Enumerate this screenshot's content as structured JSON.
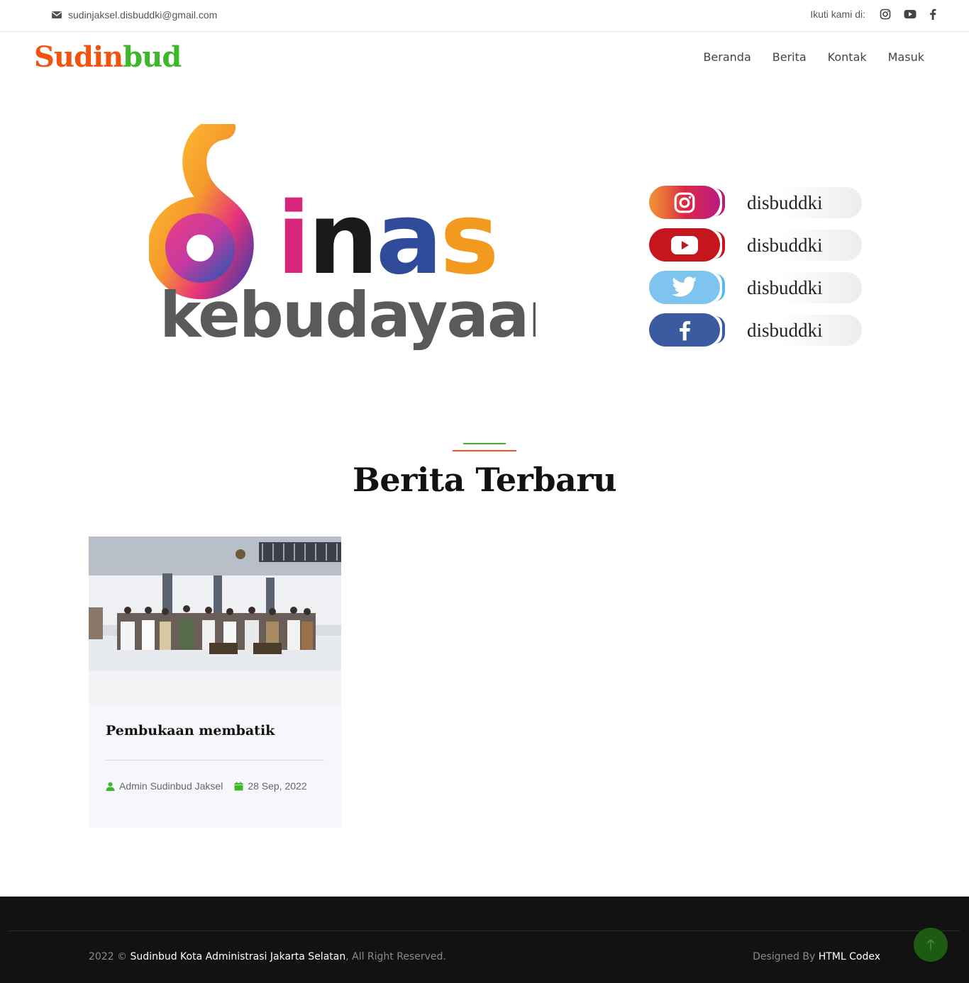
{
  "topbar": {
    "email": "sudinjaksel.disbuddki@gmail.com",
    "follow_label": "Ikuti kami di:",
    "social_icons": [
      "instagram-icon",
      "youtube-icon",
      "facebook-icon"
    ]
  },
  "navbar": {
    "brand_part1": "Sudin",
    "brand_part2": "bud",
    "links": [
      "Beranda",
      "Berita",
      "Kontak",
      "Masuk"
    ]
  },
  "hero": {
    "logo_text_top": "dinas",
    "logo_text_bottom": "kebudayaan",
    "socials": [
      {
        "icon": "instagram-icon",
        "handle": "disbuddki",
        "color": "#e1306c"
      },
      {
        "icon": "youtube-icon",
        "handle": "disbuddki",
        "color": "#c4161c"
      },
      {
        "icon": "twitter-icon",
        "handle": "disbuddki",
        "color": "#5bb8ec"
      },
      {
        "icon": "facebook-icon",
        "handle": "disbuddki",
        "color": "#3a5ba0"
      }
    ]
  },
  "news": {
    "section_title": "Berita Terbaru",
    "items": [
      {
        "title": "Pembukaan membatik",
        "author": "Admin Sudinbud Jaksel",
        "date": "28 Sep, 2022"
      }
    ]
  },
  "footer": {
    "year": "2022 ©",
    "org": "Sudinbud Kota Administrasi Jakarta Selatan",
    "rights": ", All Right Reserved.",
    "designed_by_label": "Designed By",
    "designer": "HTML Codex"
  },
  "colors": {
    "accent_orange": "#f0540f",
    "accent_green": "#3cb82a",
    "footer_bg": "#131212",
    "back_to_top": "#1d5a12"
  }
}
